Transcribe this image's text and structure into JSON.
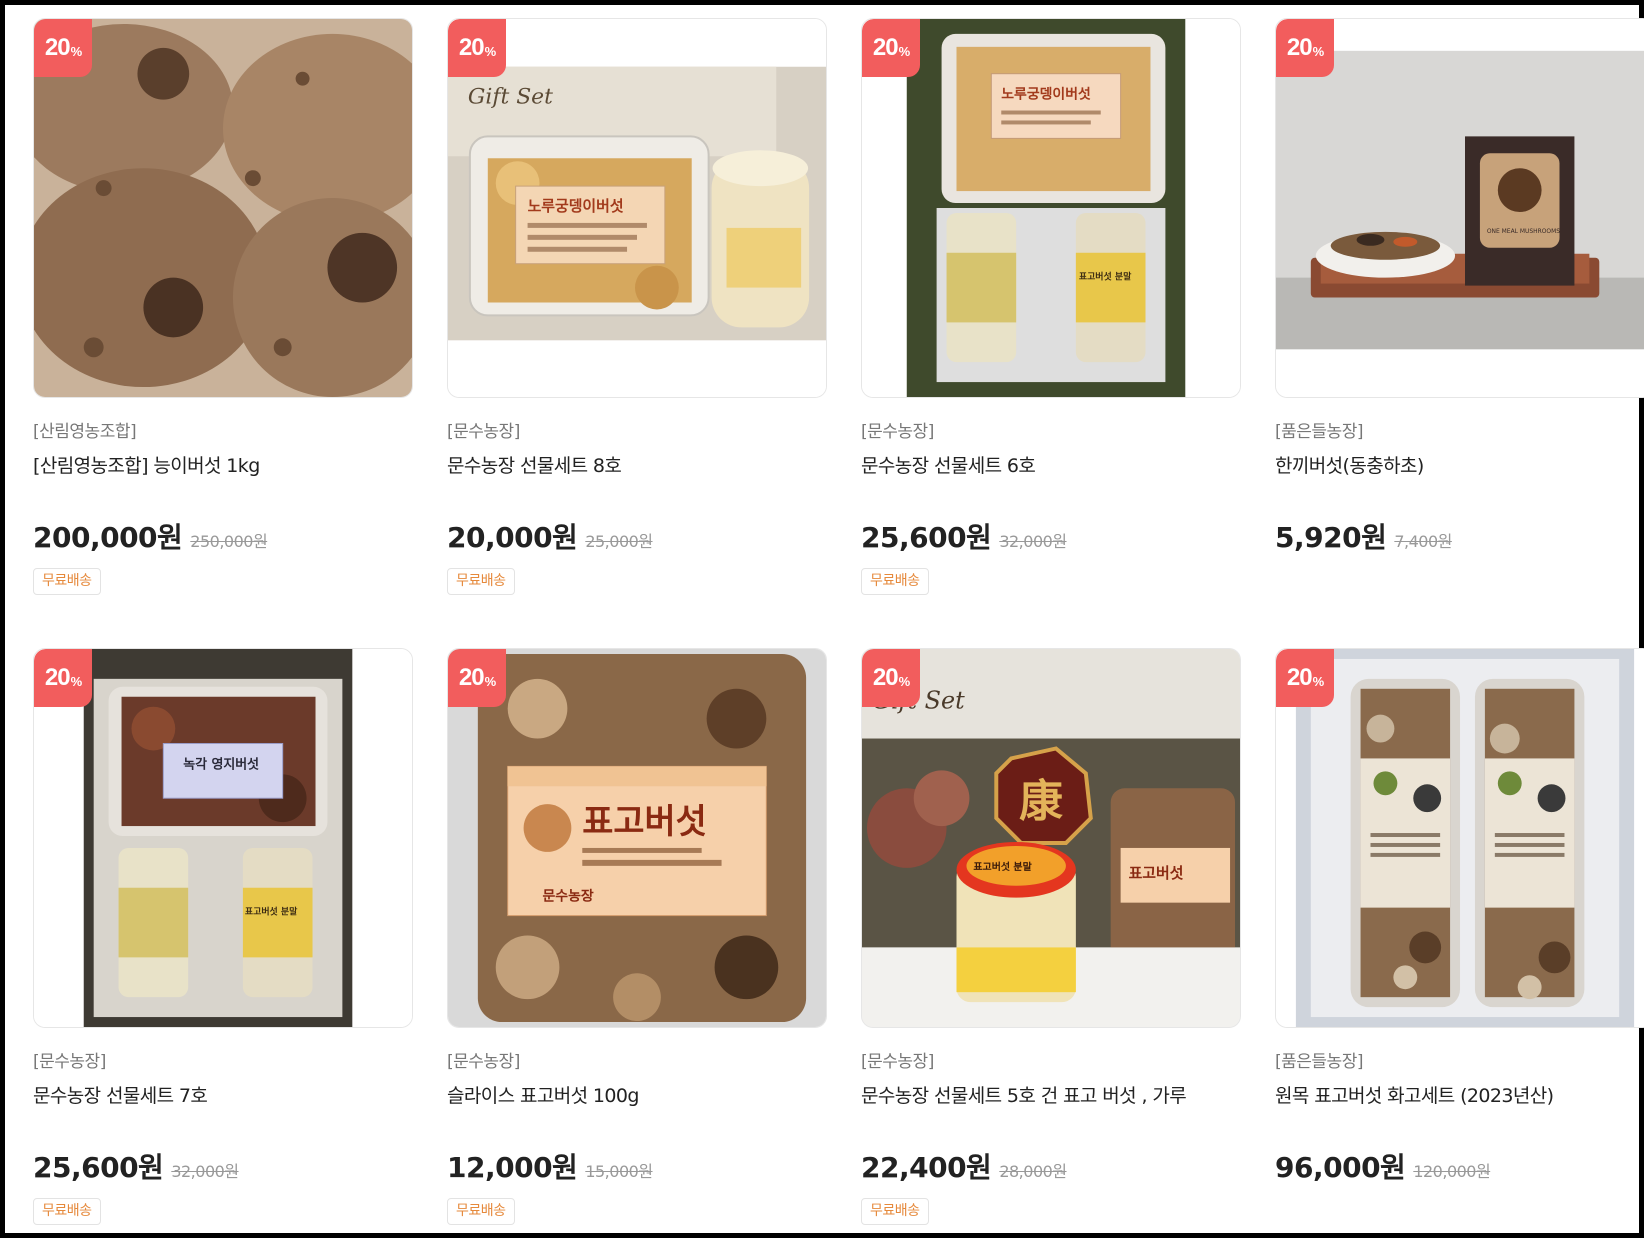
{
  "colors": {
    "badge": "#f25d5d",
    "price": "#222222",
    "original_price": "#999999",
    "seller": "#777777",
    "shipping": "#e6893b"
  },
  "products": [
    {
      "discount": "20",
      "discount_unit": "%",
      "seller": "[산림영농조합]",
      "title": "[산림영농조합] 능이버섯 1kg",
      "price": "200,000원",
      "original_price": "250,000원",
      "shipping": "무료배송",
      "image": "dried-neungi-mushrooms-photo"
    },
    {
      "discount": "20",
      "discount_unit": "%",
      "seller": "[문수농장]",
      "title": "문수농장 선물세트 8호",
      "price": "20,000원",
      "original_price": "25,000원",
      "shipping": "무료배송",
      "image": "gift-set-lion-mane-mushroom-photo",
      "image_text": [
        "Gift Set",
        "노루궁뎅이버섯"
      ]
    },
    {
      "discount": "20",
      "discount_unit": "%",
      "seller": "[문수농장]",
      "title": "문수농장 선물세트 6호",
      "price": "25,600원",
      "original_price": "32,000원",
      "shipping": "무료배송",
      "image": "gift-set-box-with-powder-bottles-photo",
      "image_text": [
        "노루궁뎅이버섯",
        "표고버섯 분말"
      ]
    },
    {
      "discount": "20",
      "discount_unit": "%",
      "seller": "[품은들농장]",
      "title": "한끼버섯(동충하초)",
      "price": "5,920원",
      "original_price": "7,400원",
      "shipping": "",
      "image": "meal-mushroom-box-on-tray-photo",
      "image_text": [
        "ONE MEAL MUSHROOMS"
      ]
    },
    {
      "discount": "20",
      "discount_unit": "%",
      "seller": "[문수농장]",
      "title": "문수농장 선물세트 7호",
      "price": "25,600원",
      "original_price": "32,000원",
      "shipping": "무료배송",
      "image": "gift-set-reishi-mushroom-photo",
      "image_text": [
        "녹각 영지버섯",
        "표고버섯 분말"
      ]
    },
    {
      "discount": "20",
      "discount_unit": "%",
      "seller": "[문수농장]",
      "title": "슬라이스 표고버섯 100g",
      "price": "12,000원",
      "original_price": "15,000원",
      "shipping": "무료배송",
      "image": "sliced-shiitake-container-photo",
      "image_text": [
        "표고버섯",
        "문수농장"
      ]
    },
    {
      "discount": "20",
      "discount_unit": "%",
      "seller": "[문수농장]",
      "title": "문수농장 선물세트 5호 건 표고 버섯 , 가루",
      "price": "22,400원",
      "original_price": "28,000원",
      "shipping": "무료배송",
      "image": "gift-set-shiitake-and-powder-photo",
      "image_text": [
        "Gift Set",
        "康",
        "표고버섯 분말",
        "표고버섯"
      ]
    },
    {
      "discount": "20",
      "discount_unit": "%",
      "seller": "[품은들농장]",
      "title": "원목 표고버섯 화고세트 (2023년산)",
      "price": "96,000원",
      "original_price": "120,000원",
      "shipping": "",
      "image": "shiitake-jars-gift-box-photo"
    }
  ]
}
